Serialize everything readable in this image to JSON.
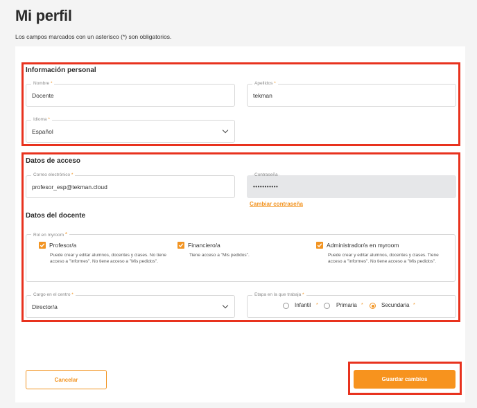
{
  "page": {
    "title": "Mi perfil",
    "required_note": "Los campos marcados con un asterisco (*) son obligatorios."
  },
  "personal": {
    "section_title": "Información personal",
    "nombre": {
      "label": "Nombre",
      "value": "Docente"
    },
    "apellidos": {
      "label": "Apellidos",
      "value": "tekman"
    },
    "idioma": {
      "label": "Idioma",
      "value": "Español"
    }
  },
  "access": {
    "section_title": "Datos de acceso",
    "email": {
      "label": "Correo electrónico",
      "value": "profesor_esp@tekman.cloud"
    },
    "password": {
      "label": "Contraseña",
      "value": "•••••••••••"
    },
    "change_password_link": "Cambiar contraseña"
  },
  "teacher": {
    "section_title": "Datos del docente",
    "roles_label": "Rol en myroom",
    "roles": [
      {
        "label": "Profesor/a",
        "checked": true,
        "description": "Puede crear y editar alumnos, docentes y clases. No tiene acceso a \"informes\". No tiene acceso a \"Mis pedidos\"."
      },
      {
        "label": "Financiero/a",
        "checked": true,
        "description": "Tiene acceso a \"Mis pedidos\"."
      },
      {
        "label": "Administrador/a en myroom",
        "checked": true,
        "description": "Puede crear y editar alumnos, docentes y clases. Tiene acceso a \"informes\". No tiene acceso a \"Mis pedidos\"."
      }
    ],
    "cargo": {
      "label": "Cargo en el centro",
      "value": "Director/a"
    },
    "etapa": {
      "label": "Etapa en la que trabaja",
      "options": [
        {
          "label": "Infantil",
          "selected": false
        },
        {
          "label": "Primaria",
          "selected": false
        },
        {
          "label": "Secundaria",
          "selected": true
        }
      ]
    }
  },
  "actions": {
    "cancel_label": "Cancelar",
    "save_label": "Guardar cambios"
  },
  "colors": {
    "accent": "#f29422",
    "highlight_border": "#e8321e"
  },
  "required_marker": "*"
}
